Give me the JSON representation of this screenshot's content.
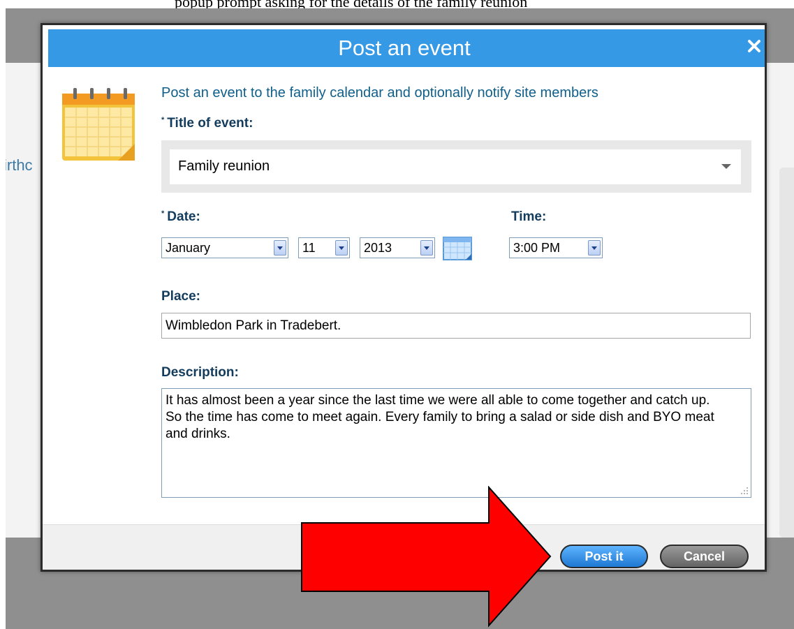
{
  "page": {
    "top_caption": "popup prompt asking for the details of the family reunion",
    "background_fragment": "irthc"
  },
  "dialog": {
    "title": "Post an event",
    "close_glyph": "✕",
    "intro": "Post an event to the family calendar and optionally notify site members",
    "required_marker": "*",
    "title_field": {
      "label": "Title of event:",
      "value": "Family reunion"
    },
    "date": {
      "label": "Date:",
      "month": "January",
      "day": "11",
      "year": "2013"
    },
    "time": {
      "label": "Time:",
      "value": "3:00 PM"
    },
    "place": {
      "label": "Place:",
      "value": "Wimbledon Park in Tradebert."
    },
    "description": {
      "label": "Description:",
      "value": "It has almost been a year since the last time we were all able to come together and catch up. So the time has come to meet again. Every family to bring a salad or side dish and BYO meat and drinks."
    },
    "buttons": {
      "post": "Post it",
      "cancel": "Cancel"
    }
  },
  "icons": {
    "calendar": "calendar-icon",
    "date_picker": "date-picker-icon",
    "close": "close-icon",
    "arrow": "red-arrow-annotation"
  },
  "colors": {
    "title_bar": "#3599e6",
    "label": "#133c5c",
    "intro": "#0f5f8a",
    "post_button": "#1f78d2",
    "cancel_button": "#646464",
    "arrow": "#ff0000"
  }
}
